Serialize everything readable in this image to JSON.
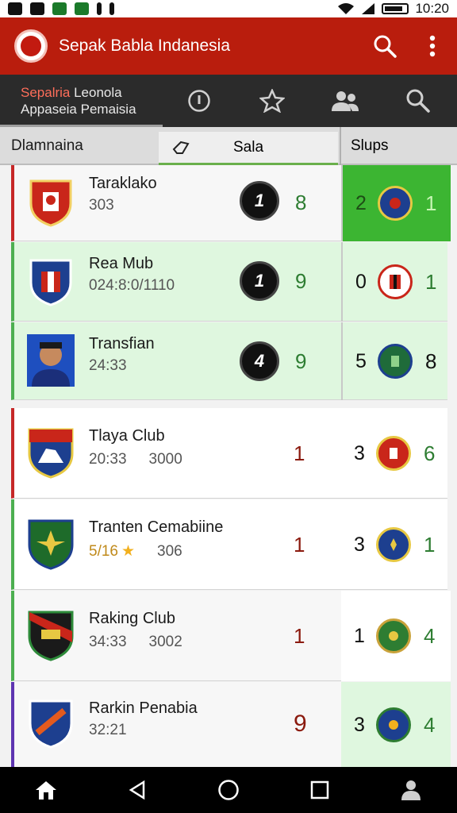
{
  "status_bar": {
    "time": "10:20"
  },
  "app_bar": {
    "title": "Sepak Babla Indanesia"
  },
  "tabs": {
    "active_line1_a": "Sepalria",
    "active_line1_b": " Leonola",
    "active_line2": "Appaseia Pemaisia"
  },
  "columns": {
    "col1": "Dlamnaina",
    "col2": "Sala",
    "col3": "Slups"
  },
  "rows": [
    {
      "name": "Taraklako",
      "meta_a": "303",
      "meta_b": "",
      "circle": "1",
      "mid": "8",
      "right_a": "2",
      "right_b": "1"
    },
    {
      "name": "Rea Mub",
      "meta_a": "024:8:0/1110",
      "meta_b": "",
      "circle": "1",
      "mid": "9",
      "right_a": "0",
      "right_b": "1"
    },
    {
      "name": "Transfian",
      "meta_a": "24:33",
      "meta_b": "",
      "circle": "4",
      "mid": "9",
      "right_a": "5",
      "right_b": "8"
    },
    {
      "name": "Tlaya Club",
      "meta_a": "20:33",
      "meta_b": "3000",
      "mid": "1",
      "right_a": "3",
      "right_b": "6"
    },
    {
      "name": "Tranten Cemabiine",
      "meta_a": "5/16",
      "meta_b": "306",
      "mid": "1",
      "right_a": "3",
      "right_b": "1"
    },
    {
      "name": "Raking Club",
      "meta_a": "34:33",
      "meta_b": "3002",
      "mid": "1",
      "right_a": "1",
      "right_b": "4"
    },
    {
      "name": "Rarkin Penabia",
      "meta_a": "32:21",
      "meta_b": "",
      "mid": "9",
      "right_a": "3",
      "right_b": "4"
    }
  ],
  "colors": {
    "primary": "#b91d0d",
    "tab_bar": "#2b2b2b",
    "highlight_green": "#dff7df",
    "strong_green": "#3cb532",
    "score_green": "#2e7d32"
  },
  "icons": [
    "search-icon",
    "more-vert-icon",
    "info-icon",
    "star-icon",
    "people-icon",
    "home-icon",
    "back-icon",
    "circle-home-icon",
    "recents-icon",
    "profile-icon"
  ]
}
